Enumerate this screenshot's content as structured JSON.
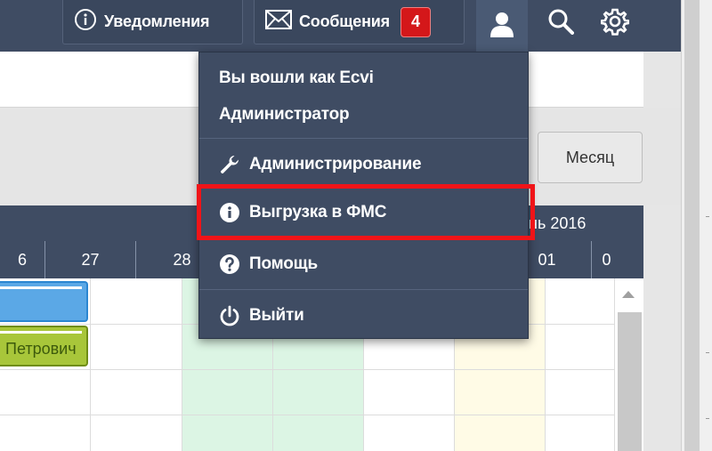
{
  "topbar": {
    "notifications_label": "Уведомления",
    "messages_label": "Сообщения",
    "messages_count": "4",
    "icons": [
      "info-icon",
      "envelope-icon",
      "user-icon",
      "search-icon",
      "gear-icon"
    ]
  },
  "toolbar": {
    "month_button": "Месяц"
  },
  "calendar": {
    "month_label": "нь 2016",
    "days": [
      "6",
      "27",
      "28",
      "01",
      "0"
    ],
    "events": [
      {
        "label": "",
        "color": "#5ba8e6"
      },
      {
        "label": "Петрович",
        "color": "#a8c63a"
      }
    ]
  },
  "user_menu": {
    "logged_in_as": "Вы вошли как Ecvi",
    "role": "Администратор",
    "items": [
      {
        "label": "Администрирование",
        "icon": "wrench-icon"
      },
      {
        "label": "Выгрузка в ФМС",
        "icon": "info-circle-icon",
        "highlighted": true
      },
      {
        "label": "Помощь",
        "icon": "question-circle-icon"
      },
      {
        "label": "Выйти",
        "icon": "power-icon"
      }
    ]
  },
  "colors": {
    "header": "#3f4c63",
    "badge": "#d4171a",
    "highlight_border": "#f01418",
    "event_blue": "#5ba8e6",
    "event_green": "#a8c63a"
  }
}
